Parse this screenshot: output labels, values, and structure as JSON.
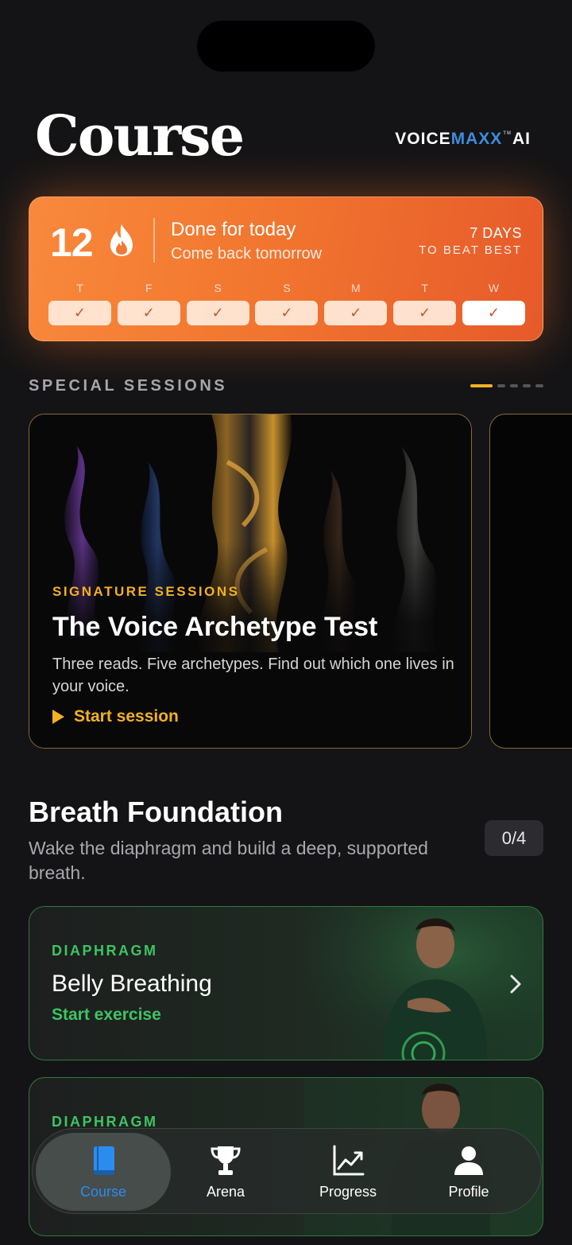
{
  "header": {
    "title": "Course",
    "brand_voice": "VOICE",
    "brand_maxx": "MAXX",
    "brand_tm": "TM",
    "brand_ai": "AI"
  },
  "streak": {
    "count": "12",
    "status": "Done for today",
    "subtitle": "Come back tomorrow",
    "beat_days": "7 DAYS",
    "beat_label": "TO BEAT BEST",
    "days": [
      {
        "letter": "T",
        "check": "✓"
      },
      {
        "letter": "F",
        "check": "✓"
      },
      {
        "letter": "S",
        "check": "✓"
      },
      {
        "letter": "S",
        "check": "✓"
      },
      {
        "letter": "M",
        "check": "✓"
      },
      {
        "letter": "T",
        "check": "✓"
      },
      {
        "letter": "W",
        "check": "✓"
      }
    ],
    "accent": "#f2762f"
  },
  "special_sessions": {
    "label": "SPECIAL SESSIONS",
    "pager_total": 5,
    "pager_active": 1,
    "card": {
      "kicker": "SIGNATURE SESSIONS",
      "title": "The Voice Archetype Test",
      "description": "Three reads. Five archetypes. Find out which one lives in your voice.",
      "cta": "Start session"
    },
    "accent": "#f3b022"
  },
  "module": {
    "title": "Breath Foundation",
    "description": "Wake the diaphragm and build a deep, supported breath.",
    "count": "0/4",
    "exercises": [
      {
        "kicker": "DIAPHRAGM",
        "title": "Belly Breathing",
        "cta": "Start exercise"
      },
      {
        "kicker": "DIAPHRAGM"
      }
    ],
    "accent": "#3ec463"
  },
  "tabbar": {
    "tabs": [
      {
        "label": "Course",
        "icon": "book-icon",
        "active": true
      },
      {
        "label": "Arena",
        "icon": "trophy-icon",
        "active": false
      },
      {
        "label": "Progress",
        "icon": "chart-icon",
        "active": false
      },
      {
        "label": "Profile",
        "icon": "person-icon",
        "active": false
      }
    ],
    "active_color": "#2b8cf0"
  }
}
